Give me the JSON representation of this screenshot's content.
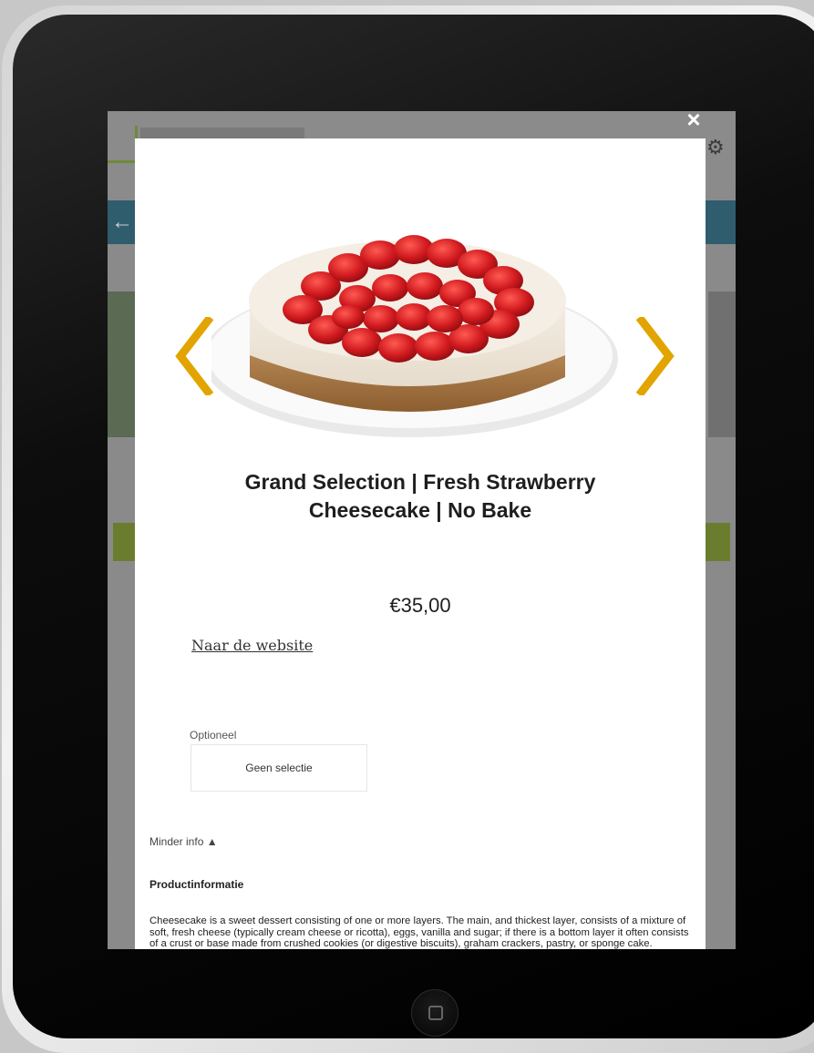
{
  "background_site": {
    "settings_icon": "gear-icon",
    "back_icon": "arrow-left-icon"
  },
  "modal": {
    "close_icon": "close-icon",
    "close_label": "×",
    "prev_icon": "chevron-left-icon",
    "next_icon": "chevron-right-icon",
    "arrow_color": "#e2a400",
    "product": {
      "title_line1": "Grand Selection | Fresh Strawberry",
      "title_line2": "Cheesecake | No Bake",
      "price": "€35,00",
      "website_link": "Naar de website"
    },
    "options": {
      "label": "Optioneel",
      "selected": "Geen selectie"
    },
    "info": {
      "toggle_label": "Minder info ▲",
      "section_title": "Productinformatie",
      "description": "Cheesecake is a sweet dessert consisting of one or more layers. The main, and thickest layer, consists of a mixture of soft, fresh cheese (typically cream cheese or ricotta), eggs, vanilla and sugar; if there is a bottom layer it often consists of a crust or base made from crushed cookies (or digestive biscuits), graham crackers, pastry, or sponge cake."
    }
  }
}
